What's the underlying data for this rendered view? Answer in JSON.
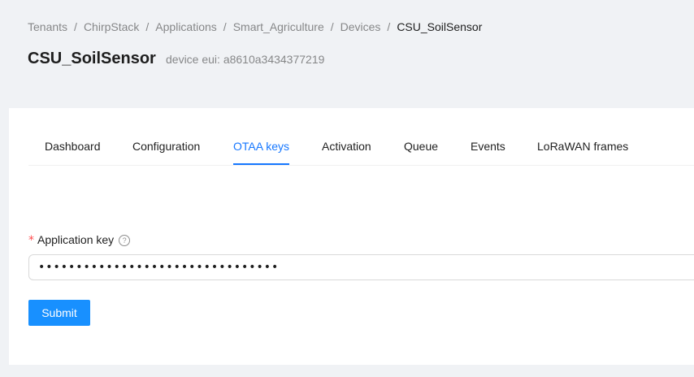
{
  "breadcrumb": {
    "items": [
      "Tenants",
      "ChirpStack",
      "Applications",
      "Smart_Agriculture",
      "Devices"
    ],
    "current": "CSU_SoilSensor",
    "separator": "/"
  },
  "header": {
    "title": "CSU_SoilSensor",
    "subtitle": "device eui: a8610a3434377219"
  },
  "tabs": [
    {
      "label": "Dashboard",
      "active": false
    },
    {
      "label": "Configuration",
      "active": false
    },
    {
      "label": "OTAA keys",
      "active": true
    },
    {
      "label": "Activation",
      "active": false
    },
    {
      "label": "Queue",
      "active": false
    },
    {
      "label": "Events",
      "active": false
    },
    {
      "label": "LoRaWAN frames",
      "active": false
    }
  ],
  "form": {
    "required_mark": "*",
    "app_key_label": "Application key",
    "help_icon": "question-circle-icon",
    "help_glyph": "?",
    "app_key_value": "••••••••••••••••••••••••••••••••",
    "submit_label": "Submit"
  },
  "colors": {
    "accent": "#1677ff",
    "submit_bg": "#1890ff",
    "required": "#ff4d4f",
    "page_bg": "#f0f2f5"
  }
}
